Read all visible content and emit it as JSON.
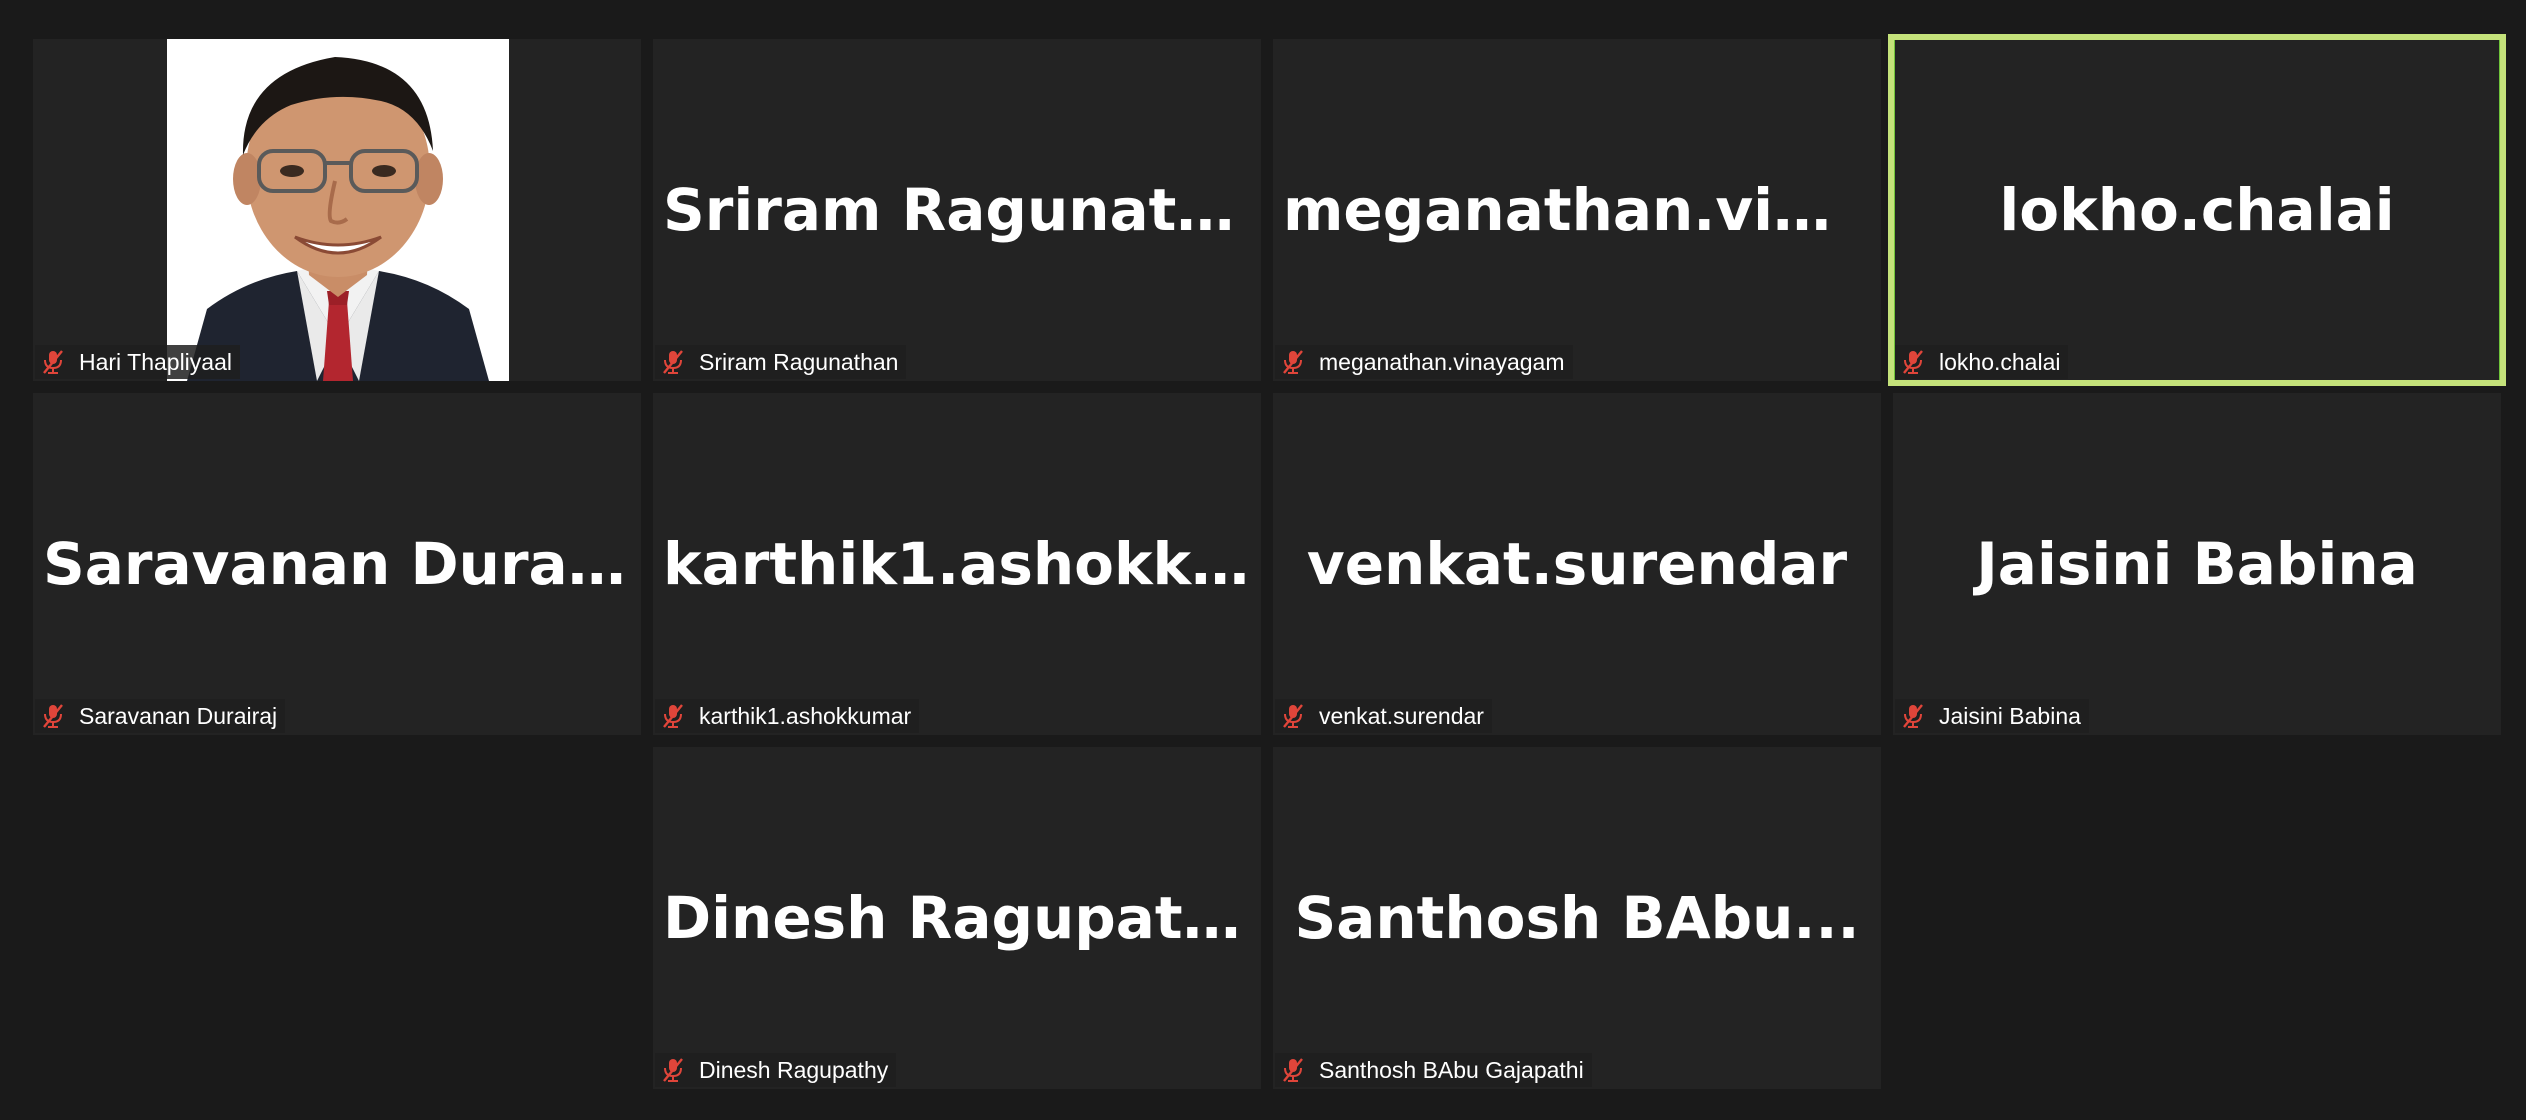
{
  "participants": [
    {
      "display_name": "",
      "label": "Hari Thapliyaal",
      "muted": true,
      "has_video": true
    },
    {
      "display_name": "Sriram  Ragunath...",
      "label": "Sriram Ragunathan",
      "muted": true
    },
    {
      "display_name": "meganathan.vin...",
      "label": "meganathan.vinayagam",
      "muted": true
    },
    {
      "display_name": "lokho.chalai",
      "label": "lokho.chalai",
      "muted": true,
      "active_speaker": true
    },
    {
      "display_name": "Saravanan  Durai...",
      "label": "Saravanan Durairaj",
      "muted": true
    },
    {
      "display_name": "karthik1.ashokk...",
      "label": "karthik1.ashokkumar",
      "muted": true
    },
    {
      "display_name": "venkat.surendar",
      "label": "venkat.surendar",
      "muted": true
    },
    {
      "display_name": "Jaisini Babina",
      "label": "Jaisini Babina",
      "muted": true
    },
    {
      "display_name": "Dinesh Ragupathy",
      "label": "Dinesh Ragupathy",
      "muted": true
    },
    {
      "display_name": "Santhosh  BAbu...",
      "label": "Santhosh BAbu Gajapathi",
      "muted": true
    }
  ],
  "colors": {
    "background": "#1a1a1a",
    "tile": "#232323",
    "active_speaker_border": "#c4e27a",
    "muted_icon": "#e0453a"
  },
  "icons": {
    "mute": "microphone-muted-icon"
  }
}
